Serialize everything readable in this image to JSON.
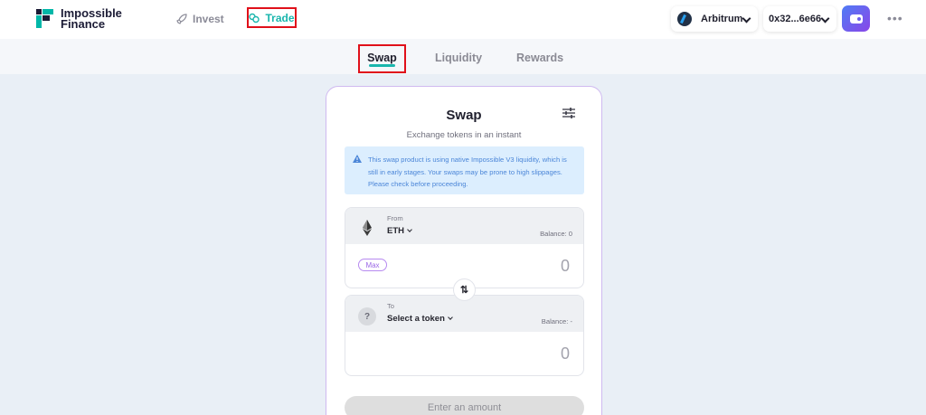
{
  "brand": {
    "name_line1": "Impossible",
    "name_line2": "Finance"
  },
  "nav": {
    "invest": "Invest",
    "trade": "Trade"
  },
  "network": {
    "label": "Arbitrum"
  },
  "account": {
    "address": "0x32...6e66"
  },
  "more": "•••",
  "tabs": {
    "swap": "Swap",
    "liquidity": "Liquidity",
    "rewards": "Rewards"
  },
  "card": {
    "title": "Swap",
    "subtitle": "Exchange tokens in an instant",
    "notice": "This swap product is using native Impossible V3 liquidity, which is still in early stages. Your swaps may be prone to high slippages. Please check before proceeding."
  },
  "from": {
    "label": "From",
    "token": "ETH",
    "balance": "Balance: 0",
    "max": "Max",
    "amount": "0"
  },
  "to": {
    "label": "To",
    "token": "Select a token",
    "token_icon": "?",
    "balance": "Balance: -",
    "amount": "0"
  },
  "swap_arrow": "⇅",
  "submit": {
    "label": "Enter an amount"
  },
  "colors": {
    "accent": "#1ab6ad",
    "highlight": "#e0101a",
    "purple": "#9a67e6"
  }
}
